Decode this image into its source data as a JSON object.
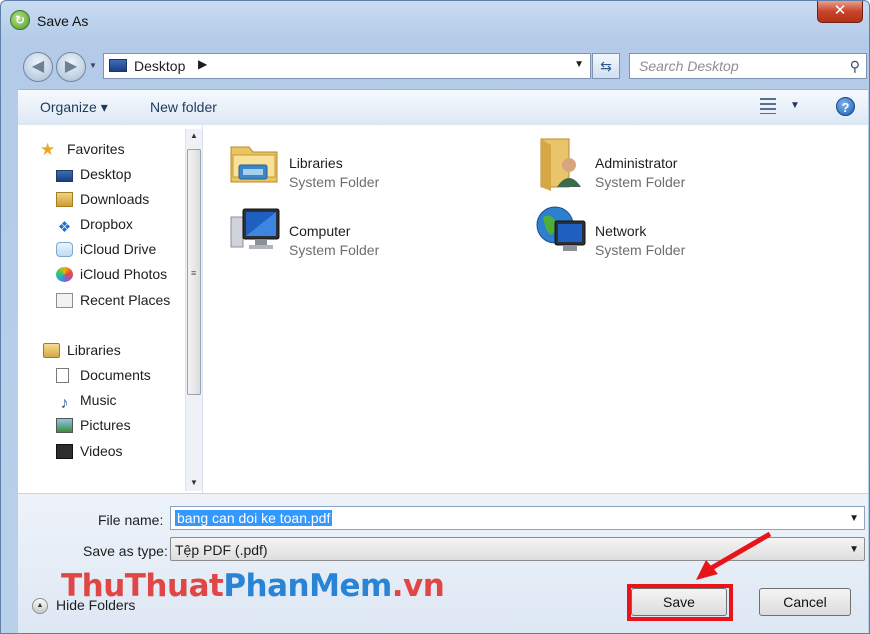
{
  "window": {
    "title": "Save As",
    "close_label": "✕"
  },
  "nav": {
    "address": "Desktop",
    "search_placeholder": "Search Desktop"
  },
  "commands": {
    "organize": "Organize ▾",
    "new_folder": "New folder"
  },
  "sidebar": {
    "favorites_header": "Favorites",
    "favorites": [
      "Desktop",
      "Downloads",
      "Dropbox",
      "iCloud Drive",
      "iCloud Photos",
      "Recent Places"
    ],
    "libraries_header": "Libraries",
    "libraries": [
      "Documents",
      "Music",
      "Pictures",
      "Videos"
    ]
  },
  "files": [
    {
      "name": "Libraries",
      "type": "System Folder",
      "icon": "libraries-icon"
    },
    {
      "name": "Administrator",
      "type": "System Folder",
      "icon": "user-folder-icon"
    },
    {
      "name": "Computer",
      "type": "System Folder",
      "icon": "computer-icon"
    },
    {
      "name": "Network",
      "type": "System Folder",
      "icon": "network-icon"
    }
  ],
  "form": {
    "file_name_label": "File name:",
    "file_name_value": "bang can doi ke toan.pdf",
    "save_type_label": "Save as type:",
    "save_type_value": "Tệp PDF (.pdf)"
  },
  "watermark": {
    "part1": "ThuThuat",
    "part2": "PhanMem",
    "part3": ".vn"
  },
  "footer": {
    "hide_folders": "Hide Folders",
    "save": "Save",
    "cancel": "Cancel"
  },
  "colors": {
    "highlight": "#e8141a",
    "selection": "#3399ff"
  }
}
